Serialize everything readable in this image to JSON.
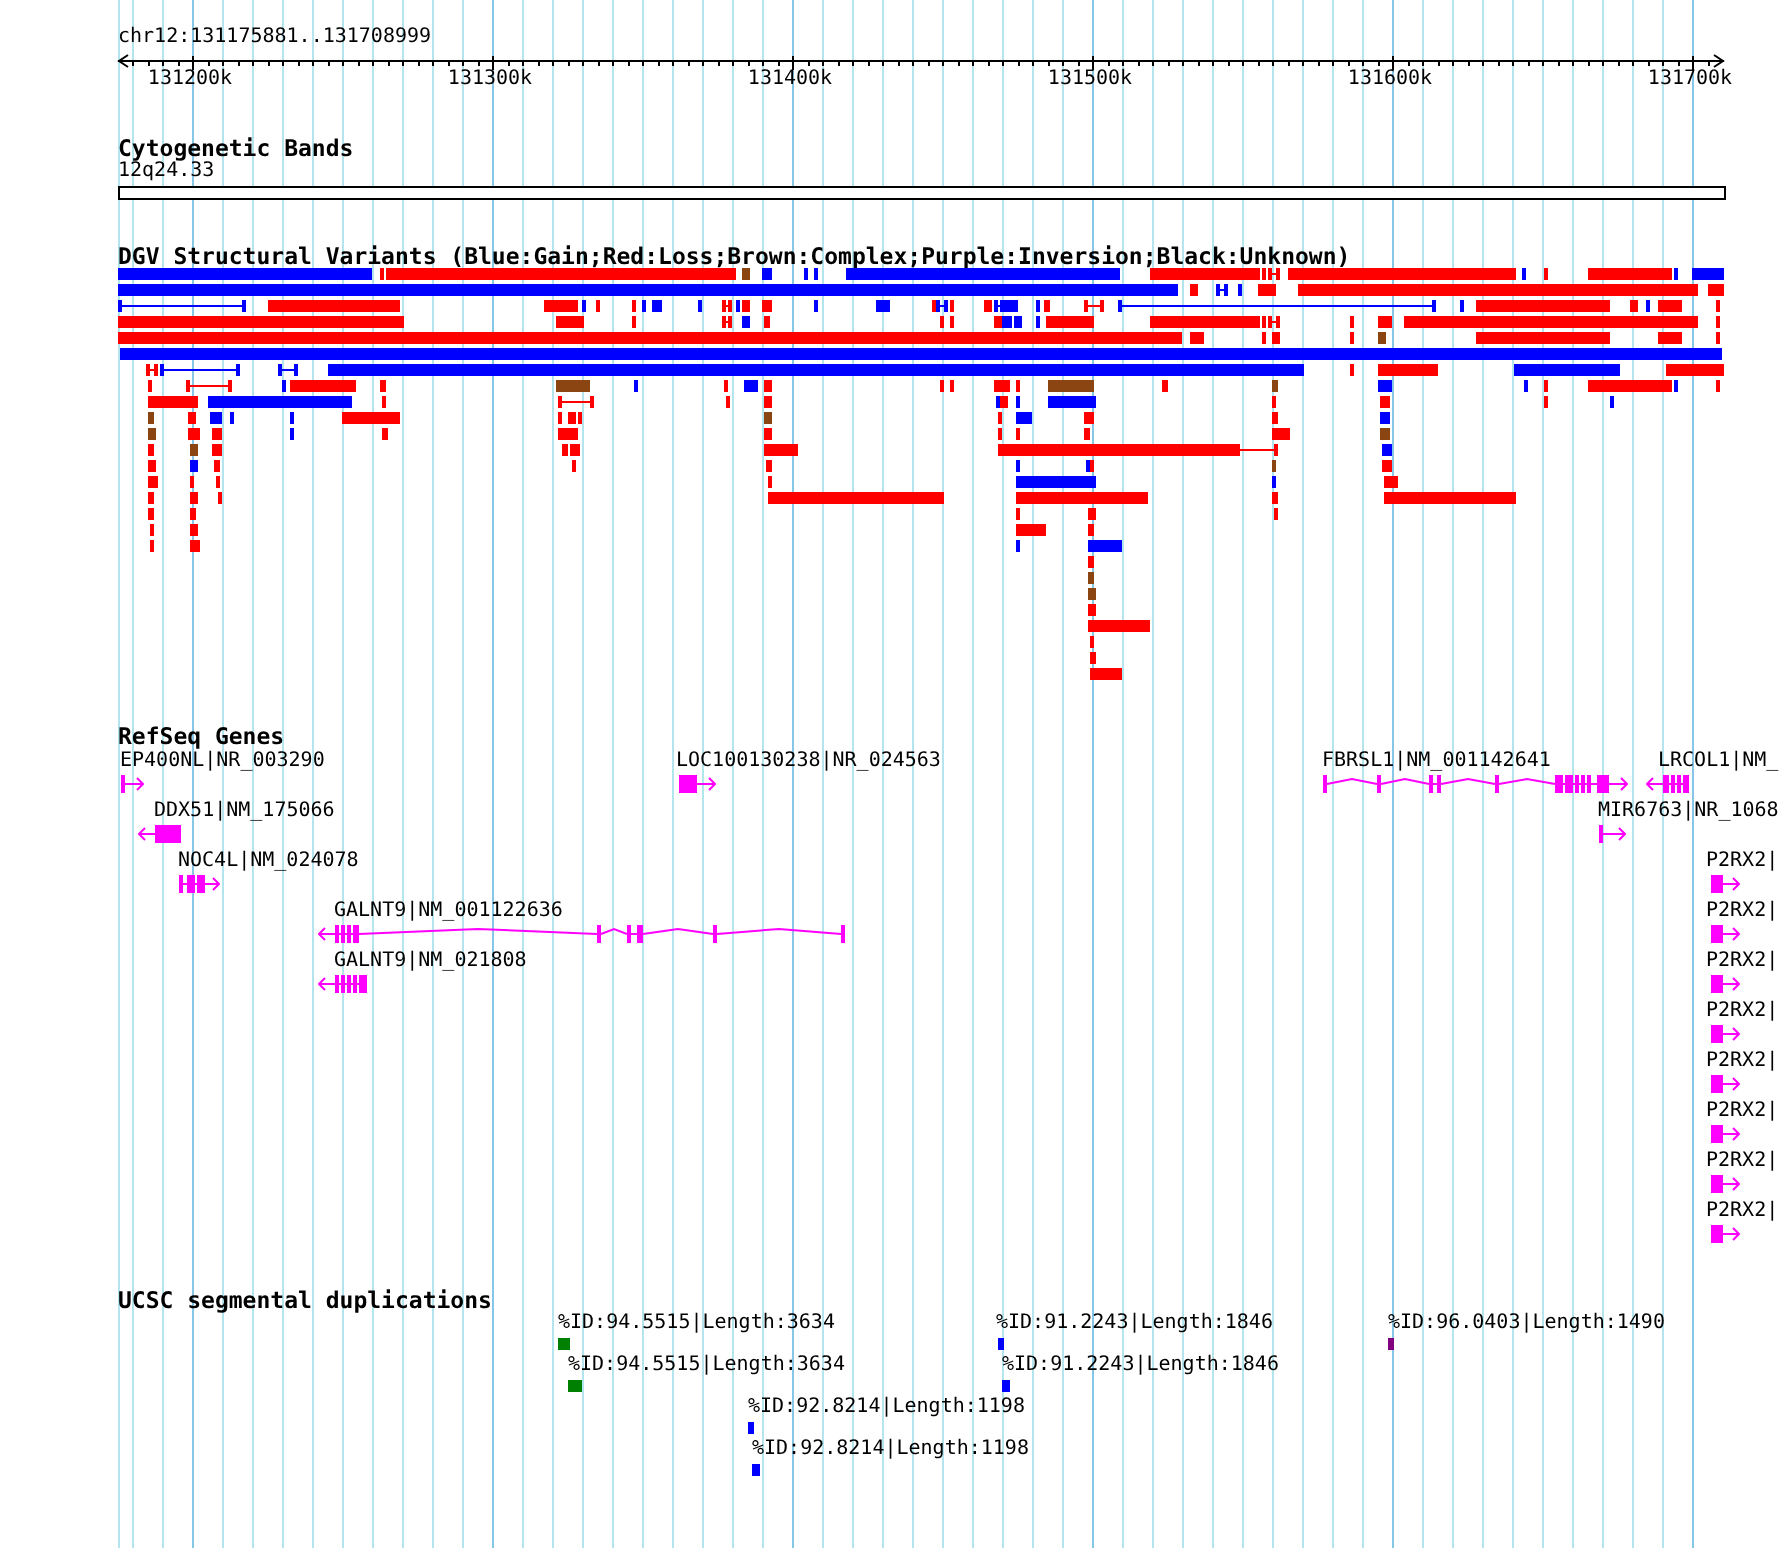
{
  "ruler": {
    "region": "chr12:131175881..131708999",
    "tick_labels": [
      "131200k",
      "131300k",
      "131400k",
      "131500k",
      "131600k",
      "131700k"
    ]
  },
  "cytogenetic_bands": {
    "title": "Cytogenetic Bands",
    "band_label": "12q24.33"
  },
  "dgv_structural_variants": {
    "title": "DGV Structural Variants (Blue:Gain;Red:Loss;Brown:Complex;Purple:Inversion;Black:Unknown)"
  },
  "refseq_genes": {
    "title": "RefSeq Genes",
    "genes": [
      {
        "label": "EP400NL|NR_003290",
        "reverse": false
      },
      {
        "label": "LOC100130238|NR_024563",
        "reverse": false
      },
      {
        "label": "FBRSL1|NM_001142641",
        "reverse": false
      },
      {
        "label": "LRCOL1|NM_",
        "reverse": true
      },
      {
        "label": "DDX51|NM_175066",
        "reverse": true
      },
      {
        "label": "MIR6763|NR_1068",
        "reverse": false
      },
      {
        "label": "NOC4L|NM_024078",
        "reverse": false
      },
      {
        "label": "P2RX2|",
        "reverse": false
      },
      {
        "label": "GALNT9|NM_001122636",
        "reverse": true
      },
      {
        "label": "P2RX2|",
        "reverse": false
      },
      {
        "label": "GALNT9|NM_021808",
        "reverse": true
      },
      {
        "label": "P2RX2|",
        "reverse": false
      },
      {
        "label": "P2RX2|",
        "reverse": false
      },
      {
        "label": "P2RX2|",
        "reverse": false
      },
      {
        "label": "P2RX2|",
        "reverse": false
      },
      {
        "label": "P2RX2|",
        "reverse": false
      },
      {
        "label": "P2RX2|",
        "reverse": false
      }
    ]
  },
  "segmental_duplications": {
    "title": "UCSC segmental duplications",
    "items": [
      {
        "label": "%ID:94.5515|Length:3634",
        "color": "#008000"
      },
      {
        "label": "%ID:91.2243|Length:1846",
        "color": "#0000ff"
      },
      {
        "label": "%ID:96.0403|Length:1490",
        "color": "#800080"
      },
      {
        "label": "%ID:94.5515|Length:3634",
        "color": "#008000"
      },
      {
        "label": "%ID:91.2243|Length:1846",
        "color": "#0000ff"
      },
      {
        "label": "%ID:92.8214|Length:1198",
        "color": "#0000ff"
      },
      {
        "label": "%ID:92.8214|Length:1198",
        "color": "#0000ff"
      }
    ]
  }
}
